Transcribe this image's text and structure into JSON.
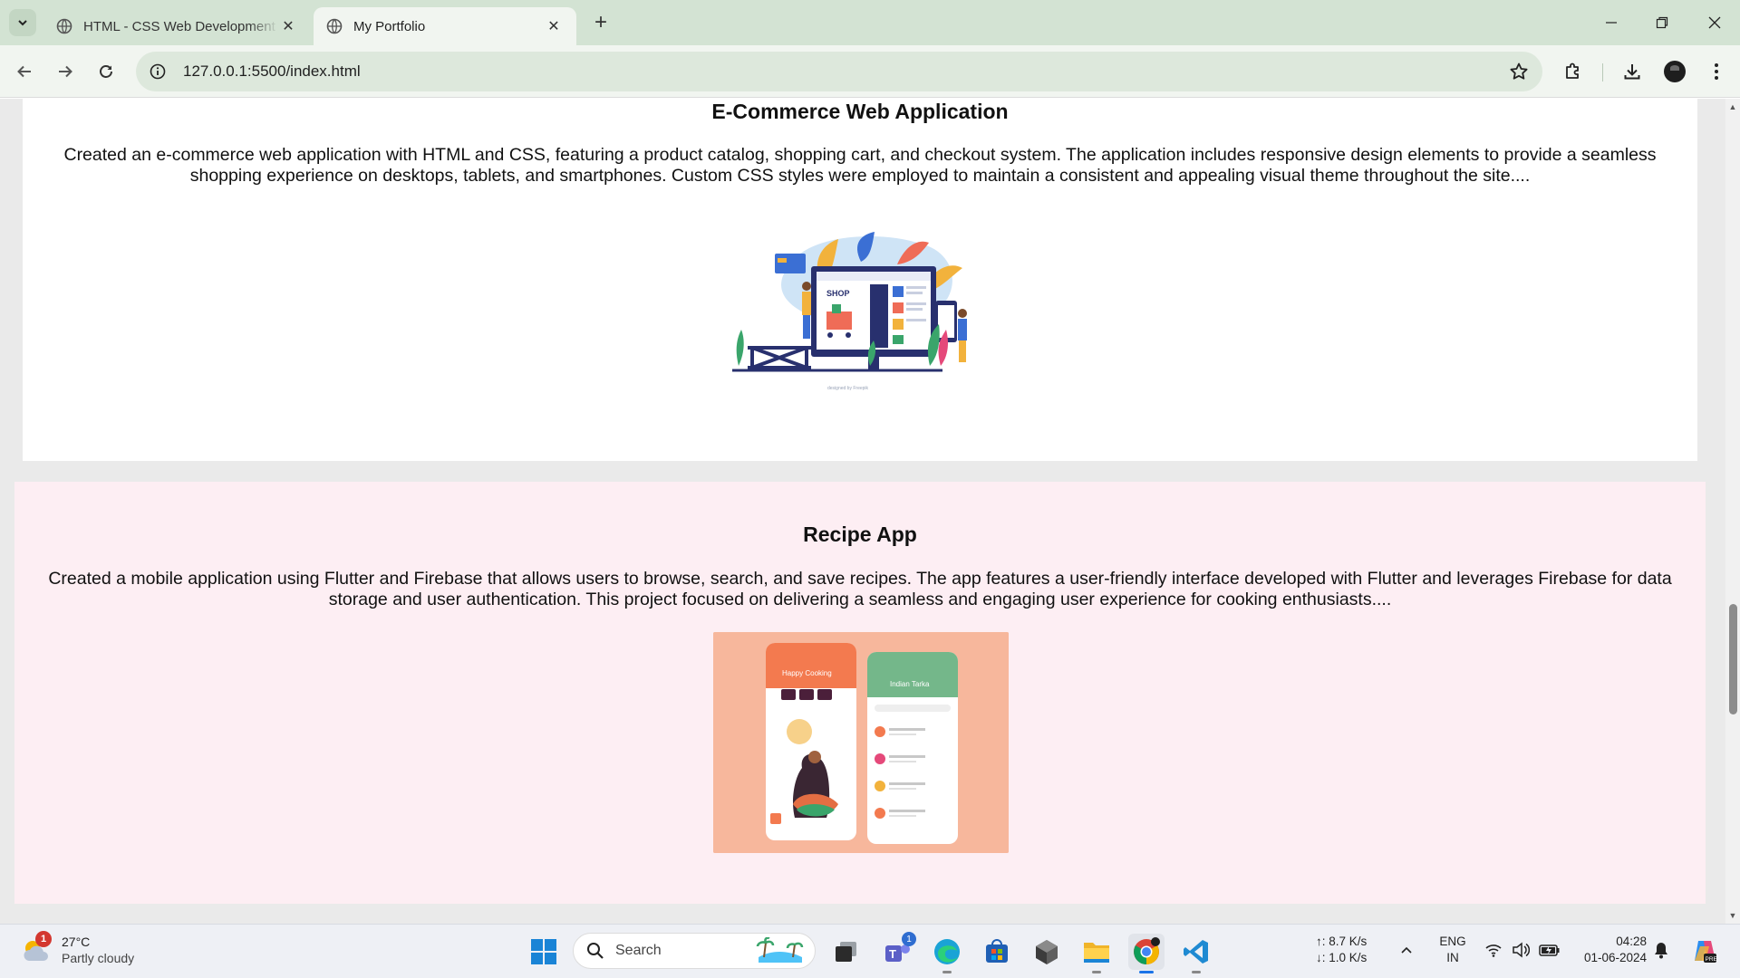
{
  "browser": {
    "tabs": [
      {
        "title": "HTML - CSS Web Development",
        "active": false
      },
      {
        "title": "My Portfolio",
        "active": true
      }
    ],
    "address": "127.0.0.1:5500/index.html"
  },
  "page": {
    "projects": [
      {
        "title": "E-Commerce Web Application",
        "description": "Created an e-commerce web application with HTML and CSS, featuring a product catalog, shopping cart, and checkout system. The application includes responsive design elements to provide a seamless shopping experience on desktops, tablets, and smartphones. Custom CSS styles were employed to maintain a consistent and appealing visual theme throughout the site....",
        "image_text": "SHOP",
        "image_credit": "designed by Freepik"
      },
      {
        "title": "Recipe App",
        "description": "Created a mobile application using Flutter and Firebase that allows users to browse, search, and save recipes. The app features a user-friendly interface developed with Flutter and leverages Firebase for data storage and user authentication. This project focused on delivering a seamless and engaging user experience for cooking enthusiasts....",
        "image_text_left": "Happy Cooking",
        "image_text_right": "Indian Tarka"
      }
    ]
  },
  "taskbar": {
    "weather": {
      "temp": "27°C",
      "condition": "Partly cloudy",
      "badge": "1"
    },
    "search_label": "Search",
    "teams_badge": "1",
    "network": {
      "up": "↑: 8.7 K/s",
      "down": "↓: 1.0 K/s"
    },
    "lang": {
      "line1": "ENG",
      "line2": "IN"
    },
    "clock": {
      "time": "04:28",
      "date": "01-06-2024"
    }
  },
  "colors": {
    "tabstrip": "#d3e3d3",
    "toolbar": "#f1f5f0",
    "recipe_card_bg": "#fdeef3",
    "recipe_image_bg": "#f7b79c"
  }
}
